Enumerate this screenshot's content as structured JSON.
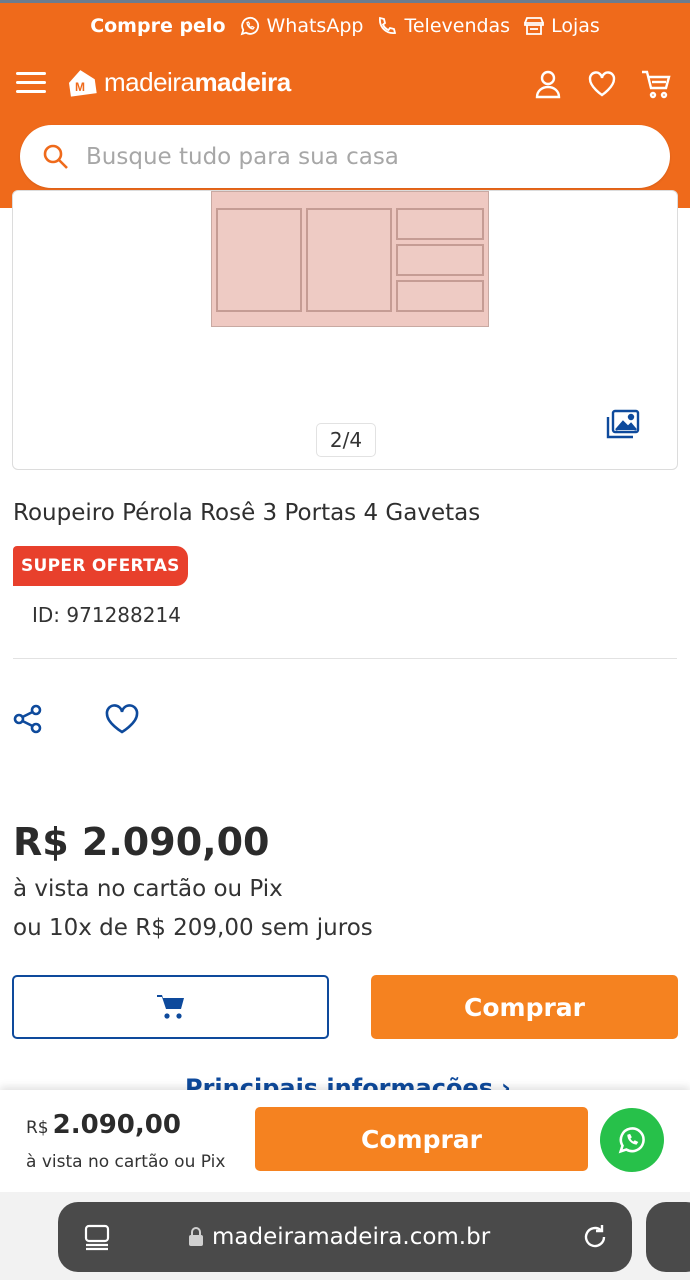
{
  "colors": {
    "header_bg": "#ef6a1b",
    "accent_orange": "#f58220",
    "brand_blue": "#0e4a9c",
    "badge_red": "#e8402c",
    "whatsapp_green": "#27c14a"
  },
  "header": {
    "promo": {
      "lead": "Compre pelo",
      "whatsapp": "WhatsApp",
      "televendas": "Televendas",
      "lojas": "Lojas"
    },
    "logo": {
      "light": "madeira",
      "bold": "madeira"
    },
    "icons": [
      "menu-icon",
      "user-icon",
      "heart-icon",
      "cart-icon"
    ],
    "search": {
      "placeholder": "Busque tudo para sua casa",
      "value": ""
    }
  },
  "gallery": {
    "counter": "2/4"
  },
  "product": {
    "title": "Roupeiro Pérola Rosê 3 Portas 4 Gavetas",
    "badge": "SUPER OFERTAS",
    "id_label": "ID: 971288214",
    "price": "R$ 2.090,00",
    "price_note": "à vista no cartão ou Pix",
    "installments": "ou 10x de R$ 209,00 sem juros",
    "buy_label": "Comprar",
    "main_info_label": "Principais informações",
    "main_info_arrow": "›"
  },
  "sticky": {
    "currency": "R$",
    "amount": "2.090,00",
    "note": "à vista no cartão ou Pix",
    "buy_label": "Comprar"
  },
  "browser": {
    "url": "madeiramadeira.com.br"
  }
}
